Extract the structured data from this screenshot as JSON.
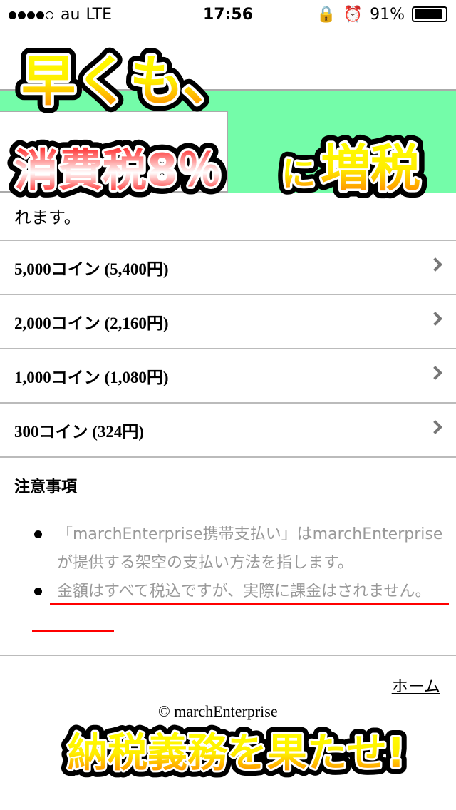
{
  "status": {
    "carrier": "au",
    "network": "LTE",
    "time": "17:56",
    "battery": "91%",
    "battery_level": 0.91,
    "signal_bars": 4
  },
  "content": {
    "fragment": "れます。"
  },
  "items": [
    {
      "label": "5,000コイン (5,400円)"
    },
    {
      "label": "2,000コイン (2,160円)"
    },
    {
      "label": "1,000コイン (1,080円)"
    },
    {
      "label": "300コイン (324円)"
    }
  ],
  "notes": {
    "heading": "注意事項",
    "items": [
      "「marchEnterprise携帯支払い」はmarchEnterpriseが提供する架空の支払い方法を指します。",
      "金額はすべて税込ですが、実際に課金はされません。"
    ]
  },
  "footer": {
    "home": "ホーム",
    "copyright": "© marchEnterprise"
  },
  "overlay": {
    "line1": "早くも、",
    "line2a": "消費税8％",
    "line2b": "に",
    "line2c": "増税",
    "bottom": "納税義務を果たせ!"
  },
  "colors": {
    "green_band": "#74fca9",
    "underline": "#ff0000"
  }
}
